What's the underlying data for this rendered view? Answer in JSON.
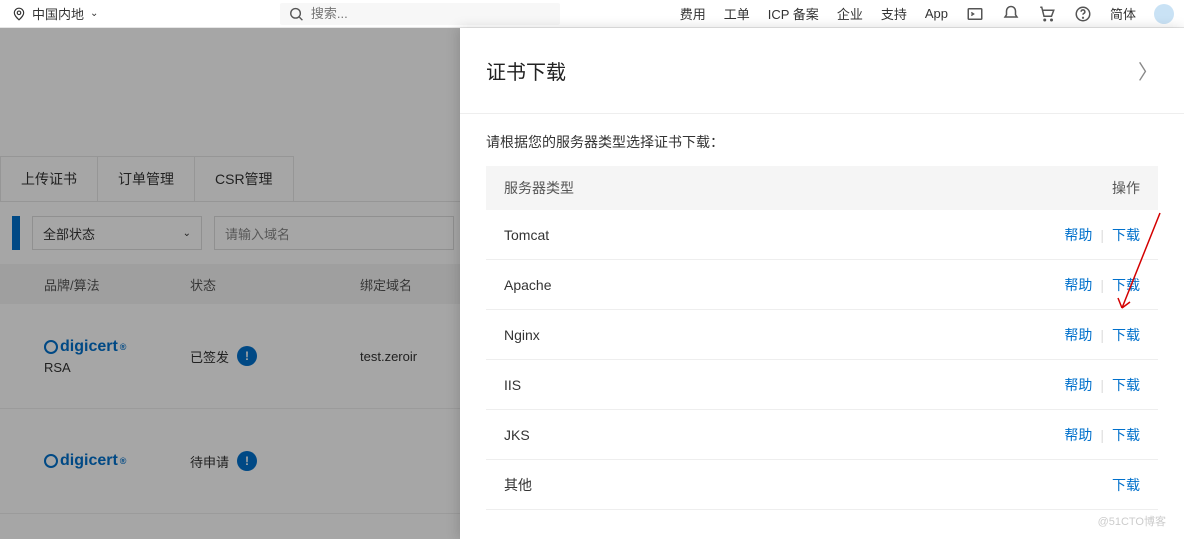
{
  "nav": {
    "region": "中国内地",
    "search_placeholder": "搜索...",
    "links": [
      "费用",
      "工单",
      "ICP 备案",
      "企业",
      "支持",
      "App"
    ],
    "lang": "简体"
  },
  "bg": {
    "tabs": [
      "上传证书",
      "订单管理",
      "CSR管理"
    ],
    "filter_status": "全部状态",
    "domain_placeholder": "请输入域名",
    "columns": {
      "brand": "品牌/算法",
      "status": "状态",
      "domain": "绑定域名"
    },
    "rows": [
      {
        "brand": "digicert",
        "algo": "RSA",
        "status": "已签发",
        "domain": "test.zeroir"
      },
      {
        "brand": "digicert",
        "algo": "",
        "status": "待申请",
        "domain": ""
      }
    ]
  },
  "panel": {
    "title": "证书下载",
    "subtitle": "请根据您的服务器类型选择证书下载：",
    "th_server": "服务器类型",
    "th_action": "操作",
    "help_label": "帮助",
    "download_label": "下载",
    "rows": [
      {
        "name": "Tomcat",
        "help": true
      },
      {
        "name": "Apache",
        "help": true
      },
      {
        "name": "Nginx",
        "help": true
      },
      {
        "name": "IIS",
        "help": true
      },
      {
        "name": "JKS",
        "help": true
      },
      {
        "name": "其他",
        "help": false
      }
    ]
  },
  "watermark": "@51CTO博客"
}
